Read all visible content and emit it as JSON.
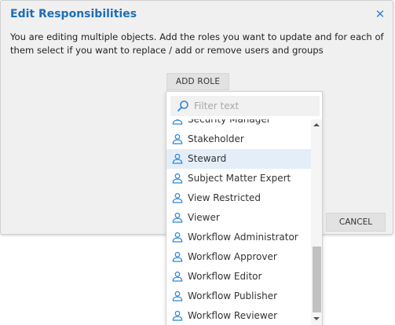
{
  "dialog": {
    "title": "Edit Responsibilities",
    "message": "You are editing multiple objects. Add the roles you want to update and for each of them select if you want to replace / add or remove users and groups",
    "add_role_label": "ADD ROLE",
    "cancel_label": "CANCEL",
    "close_icon": "close-icon"
  },
  "dropdown": {
    "filter_placeholder": "Filter text",
    "filter_icon": "search-icon",
    "item_icon": "person-icon",
    "selected_item": "Steward",
    "items": [
      {
        "label": "Security Manager"
      },
      {
        "label": "Stakeholder"
      },
      {
        "label": "Steward"
      },
      {
        "label": "Subject Matter Expert"
      },
      {
        "label": "View Restricted"
      },
      {
        "label": "Viewer"
      },
      {
        "label": "Workflow Administrator"
      },
      {
        "label": "Workflow Approver"
      },
      {
        "label": "Workflow Editor"
      },
      {
        "label": "Workflow Publisher"
      },
      {
        "label": "Workflow Reviewer"
      }
    ]
  },
  "colors": {
    "title": "#1e6eb5",
    "accent_icon": "#2f86d6",
    "selected_row": "#e4eef8",
    "dialog_background": "#f0f0f0",
    "button_background": "#e2e2e2"
  }
}
